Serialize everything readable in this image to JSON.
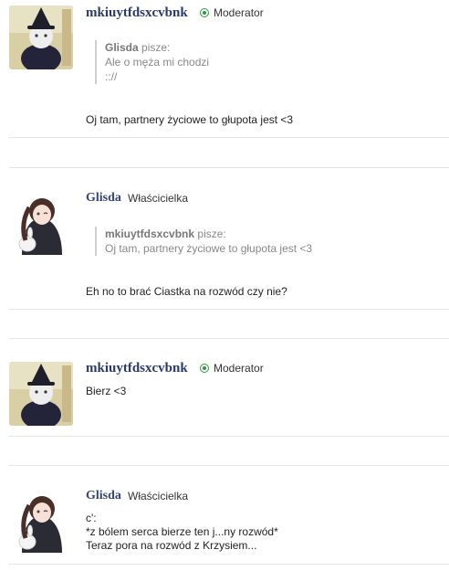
{
  "posts": [
    {
      "author": "mkiuytfdsxcvbnk",
      "role": "Moderator",
      "online": true,
      "quote": {
        "author": "Glisda",
        "word": "pisze:",
        "lines": [
          "Ale o męża mi chodzi",
          ":://"
        ]
      },
      "message": [
        "Oj tam, partnery życiowe to głupota jest <3"
      ]
    },
    {
      "author": "Glisda",
      "role": "Właścicielka",
      "online": false,
      "quote": {
        "author": "mkiuytfdsxcvbnk",
        "word": "pisze:",
        "lines": [
          "Oj tam, partnery życiowe to głupota jest <3"
        ]
      },
      "message": [
        "Eh no to brać Ciastka na rozwód czy nie?"
      ]
    },
    {
      "author": "mkiuytfdsxcvbnk",
      "role": "Moderator",
      "online": true,
      "message": [
        "Bierz <3"
      ]
    },
    {
      "author": "Glisda",
      "role": "Właścicielka",
      "online": false,
      "message": [
        "c':",
        "*z bólem serca bierze ten j...ny rozwód*",
        "Teraz pora na rozwód z Krzysiem..."
      ]
    }
  ]
}
